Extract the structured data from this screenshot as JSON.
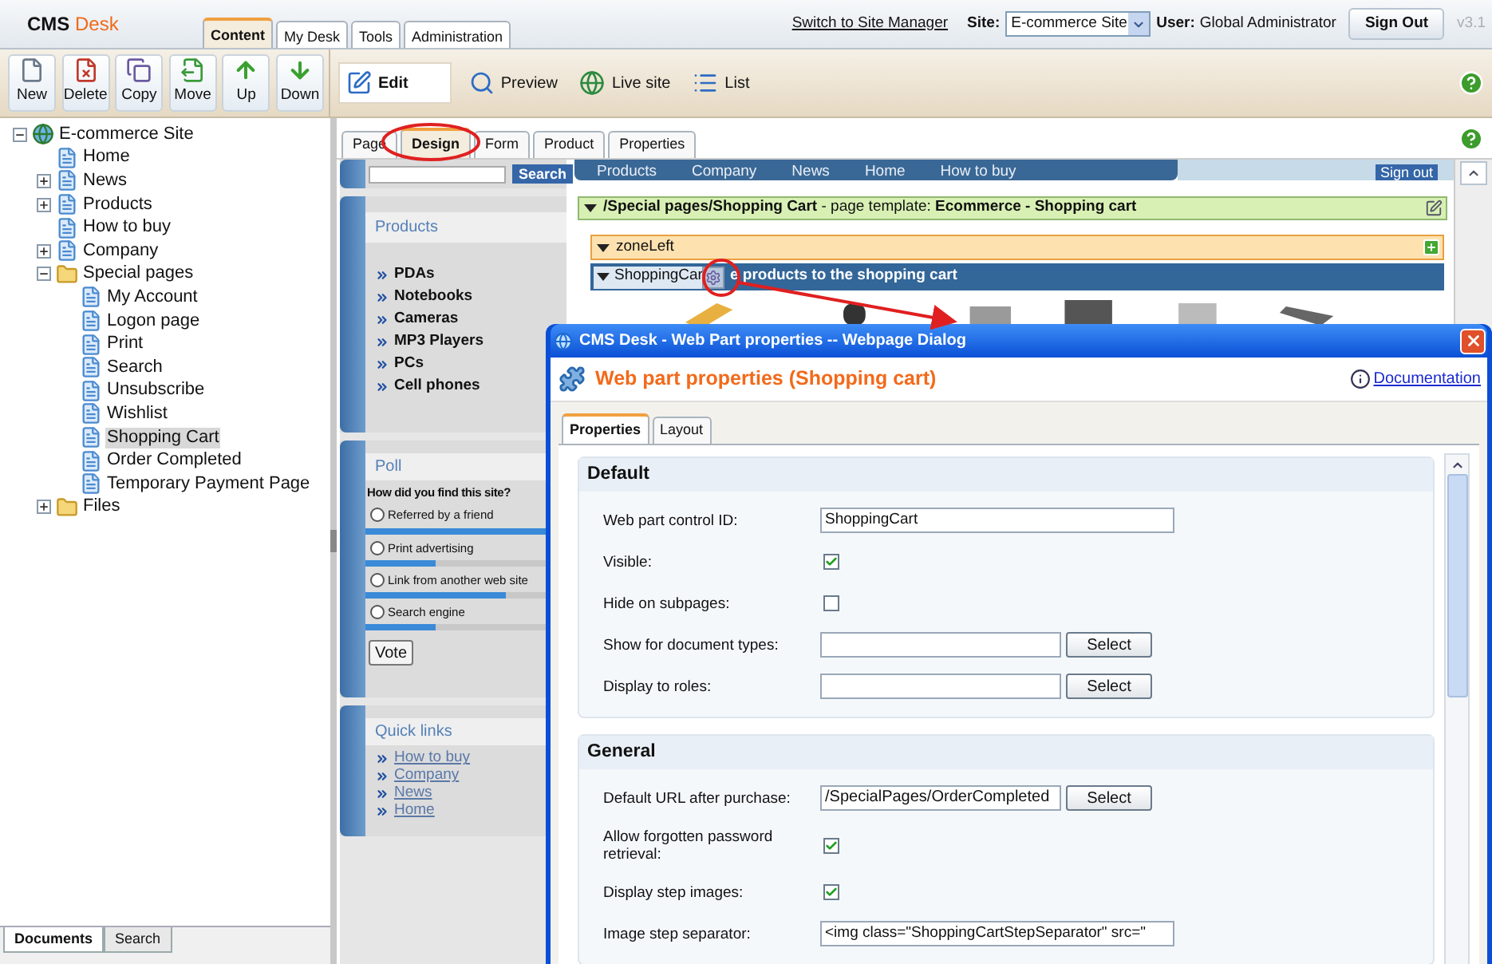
{
  "header": {
    "logo": {
      "main": "CMS",
      "accent": "Desk"
    },
    "tabs": [
      {
        "label": "Content",
        "selected": true
      },
      {
        "label": "My Desk",
        "selected": false
      },
      {
        "label": "Tools",
        "selected": false
      },
      {
        "label": "Administration",
        "selected": false
      }
    ],
    "switch_link": "Switch to Site Manager",
    "site_label": "Site:",
    "site_value": "E-commerce Site",
    "user_label": "User:",
    "user_name": "Global Administrator",
    "sign_out": "Sign Out",
    "version": "v3.1"
  },
  "toolbar": {
    "actions": [
      {
        "label": "New"
      },
      {
        "label": "Delete"
      },
      {
        "label": "Copy"
      },
      {
        "label": "Move"
      },
      {
        "label": "Up"
      },
      {
        "label": "Down"
      }
    ],
    "modes": [
      {
        "label": "Edit",
        "selected": true
      },
      {
        "label": "Preview",
        "selected": false
      },
      {
        "label": "Live site",
        "selected": false
      },
      {
        "label": "List",
        "selected": false
      }
    ]
  },
  "tree": [
    {
      "label": "E-commerce Site",
      "kind": "site",
      "expanded": true,
      "selected": false,
      "children": [
        {
          "label": "Home",
          "kind": "page",
          "selected": false
        },
        {
          "label": "News",
          "kind": "page",
          "expanded": false,
          "selected": false
        },
        {
          "label": "Products",
          "kind": "page",
          "expanded": false,
          "selected": false
        },
        {
          "label": "How to buy",
          "kind": "page",
          "selected": false
        },
        {
          "label": "Company",
          "kind": "page",
          "expanded": false,
          "selected": false
        },
        {
          "label": "Special pages",
          "kind": "folder",
          "expanded": true,
          "selected": false,
          "children": [
            {
              "label": "My Account",
              "kind": "page",
              "selected": false
            },
            {
              "label": "Logon page",
              "kind": "page",
              "selected": false
            },
            {
              "label": "Print",
              "kind": "page",
              "selected": false
            },
            {
              "label": "Search",
              "kind": "page",
              "selected": false
            },
            {
              "label": "Unsubscribe",
              "kind": "page",
              "selected": false
            },
            {
              "label": "Wishlist",
              "kind": "page",
              "selected": false
            },
            {
              "label": "Shopping Cart",
              "kind": "page",
              "selected": true
            },
            {
              "label": "Order Completed",
              "kind": "page",
              "selected": false
            },
            {
              "label": "Temporary Payment Page",
              "kind": "page",
              "selected": false
            }
          ]
        },
        {
          "label": "Files",
          "kind": "folder",
          "expanded": false,
          "selected": false
        }
      ]
    }
  ],
  "bottom_tabs": [
    {
      "label": "Documents",
      "selected": true
    },
    {
      "label": "Search",
      "selected": false
    }
  ],
  "view_tabs": [
    {
      "label": "Page",
      "selected": false
    },
    {
      "label": "Design",
      "selected": true
    },
    {
      "label": "Form",
      "selected": false
    },
    {
      "label": "Product",
      "selected": false
    },
    {
      "label": "Properties",
      "selected": false
    }
  ],
  "preview": {
    "search_button": "Search",
    "nav_items": [
      "Products",
      "Company",
      "News",
      "Home",
      "How to buy"
    ],
    "nav_sign_out": "Sign out",
    "products": {
      "title": "Products",
      "items": [
        "PDAs",
        "Notebooks",
        "Cameras",
        "MP3 Players",
        "PCs",
        "Cell phones"
      ]
    },
    "poll": {
      "title": "Poll",
      "question": "How did you find this site?",
      "options": [
        {
          "label": "Referred by a friend",
          "selected": false,
          "level": 1
        },
        {
          "label": "Print advertising",
          "selected": false,
          "level": 0.35
        },
        {
          "label": "Link from another web site",
          "selected": false,
          "level": 0.7
        },
        {
          "label": "Search engine",
          "selected": false,
          "level": 0.35
        }
      ],
      "vote": "Vote"
    },
    "quick_links": {
      "title": "Quick links",
      "items": [
        "How to buy",
        "Company",
        "News",
        "Home"
      ]
    },
    "template_bar": "**/Special pages/Shopping Cart** - page template: **Ecommerce - Shopping cart**",
    "zone": "zoneLeft",
    "webpart": {
      "name": "ShoppingCar",
      "description": "e products to the shopping cart"
    }
  },
  "dialog": {
    "title": "CMS Desk - Web Part properties -- Webpage Dialog",
    "heading": "Web part properties (Shopping cart)",
    "doc_link": "Documentation",
    "tabs": [
      {
        "label": "Properties",
        "selected": true
      },
      {
        "label": "Layout",
        "selected": false
      }
    ],
    "sections": [
      {
        "title": "Default",
        "fields": [
          {
            "label": "Web part control ID:",
            "kind": "text",
            "value": "ShoppingCart"
          },
          {
            "label": "Visible:",
            "kind": "checkbox",
            "checked": true
          },
          {
            "label": "Hide on subpages:",
            "kind": "checkbox",
            "checked": false
          },
          {
            "label": "Show for document types:",
            "kind": "picker",
            "button": "Select"
          },
          {
            "label": "Display to roles:",
            "kind": "picker",
            "button": "Select"
          }
        ]
      },
      {
        "title": "General",
        "fields": [
          {
            "label": "Default URL after purchase:",
            "kind": "picker",
            "value": "/SpecialPages/OrderCompleted",
            "button": "Select"
          },
          {
            "label": "Allow forgotten password retrieval:",
            "kind": "checkbox",
            "checked": true
          },
          {
            "label": "Display step images:",
            "kind": "checkbox",
            "checked": true
          },
          {
            "label": "Image step separator:",
            "kind": "text",
            "value": "<img class=\"ShoppingCartStepSeparator\" src=\""
          }
        ]
      }
    ]
  }
}
